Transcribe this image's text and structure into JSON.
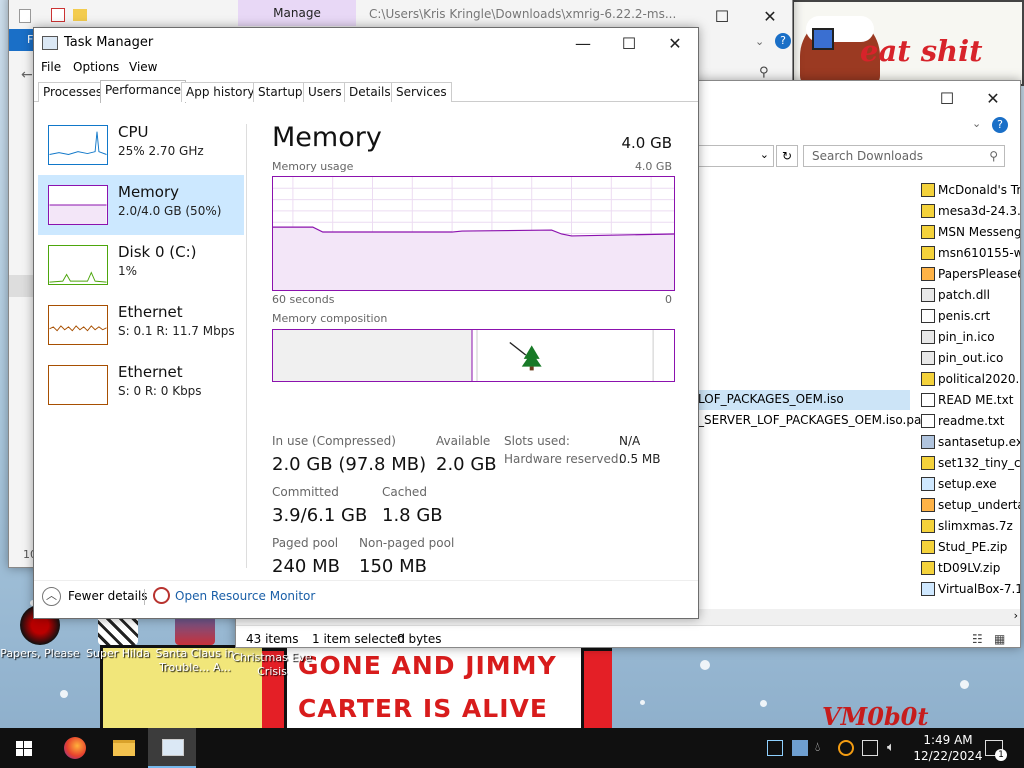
{
  "desktop": {
    "wallpaper_text_line1": "GONE AND JIMMY",
    "wallpaper_text_line2": "CARTER IS ALIVE",
    "wallpaper_signature": "VM0b0t",
    "wallpaper_top_text": "eat shit",
    "icons": [
      {
        "label": "Papers, Please"
      },
      {
        "label": "Super Hilda"
      },
      {
        "label": "Santa Claus in Trouble... A..."
      },
      {
        "label": "Christmas Eve Crisis"
      }
    ]
  },
  "explorer_back": {
    "manage_tab": "Manage",
    "path_title": "C:\\Users\\Kris Kringle\\Downloads\\xmrig-6.22.2-ms...",
    "file_tab": "F",
    "status_left": "10"
  },
  "explorer_right": {
    "search_placeholder": "Search Downloads",
    "selected_partial": "LOF_PACKAGES_OEM.iso",
    "partial_item": "_SERVER_LOF_PACKAGES_OEM.iso.part",
    "files": [
      "McDonald's Tr",
      "mesa3d-24.3.1",
      "MSN Messeng",
      "msn610155-w",
      "PapersPlease6",
      "patch.dll",
      "penis.crt",
      "pin_in.ico",
      "pin_out.ico",
      "political2020.7",
      "READ ME.txt",
      "readme.txt",
      "santasetup.exe",
      "set132_tiny_ch",
      "setup.exe",
      "setup_underta",
      "slimxmas.7z",
      "Stud_PE.zip",
      "tD09LV.zip",
      "VirtualBox-7.1"
    ],
    "status_items": "43 items",
    "status_selected": "1 item selected",
    "status_size": "0 bytes"
  },
  "taskmgr": {
    "title": "Task Manager",
    "menu": [
      "File",
      "Options",
      "View"
    ],
    "tabs": [
      "Processes",
      "Performance",
      "App history",
      "Startup",
      "Users",
      "Details",
      "Services"
    ],
    "active_tab": "Performance",
    "resources": [
      {
        "name": "CPU",
        "sub": "25%  2.70 GHz"
      },
      {
        "name": "Memory",
        "sub": "2.0/4.0 GB (50%)"
      },
      {
        "name": "Disk 0 (C:)",
        "sub": "1%"
      },
      {
        "name": "Ethernet",
        "sub": "S: 0.1  R: 11.7 Mbps"
      },
      {
        "name": "Ethernet",
        "sub": "S: 0  R: 0 Kbps"
      }
    ],
    "memory": {
      "title": "Memory",
      "total": "4.0 GB",
      "usage_label": "Memory usage",
      "usage_max": "4.0 GB",
      "time_left": "60 seconds",
      "time_right": "0",
      "composition_label": "Memory composition",
      "in_use_label": "In use (Compressed)",
      "in_use_value": "2.0 GB (97.8 MB)",
      "available_label": "Available",
      "available_value": "2.0 GB",
      "slots_label": "Slots used:",
      "slots_value": "N/A",
      "hw_reserved_label": "Hardware reserved:",
      "hw_reserved_value": "0.5 MB",
      "committed_label": "Committed",
      "committed_value": "3.9/6.1 GB",
      "cached_label": "Cached",
      "cached_value": "1.8 GB",
      "paged_label": "Paged pool",
      "paged_value": "240 MB",
      "nonpaged_label": "Non-paged pool",
      "nonpaged_value": "150 MB"
    },
    "footer": {
      "fewer_details": "Fewer details",
      "open_monitor": "Open Resource Monitor"
    }
  },
  "taskbar": {
    "time": "1:49 AM",
    "date": "12/22/2024"
  },
  "colors": {
    "memory_accent": "#8b12ae",
    "cpu_accent": "#1178c9",
    "disk_accent": "#4da60c",
    "ethernet_accent": "#a74f01",
    "selection": "#cce8ff"
  }
}
